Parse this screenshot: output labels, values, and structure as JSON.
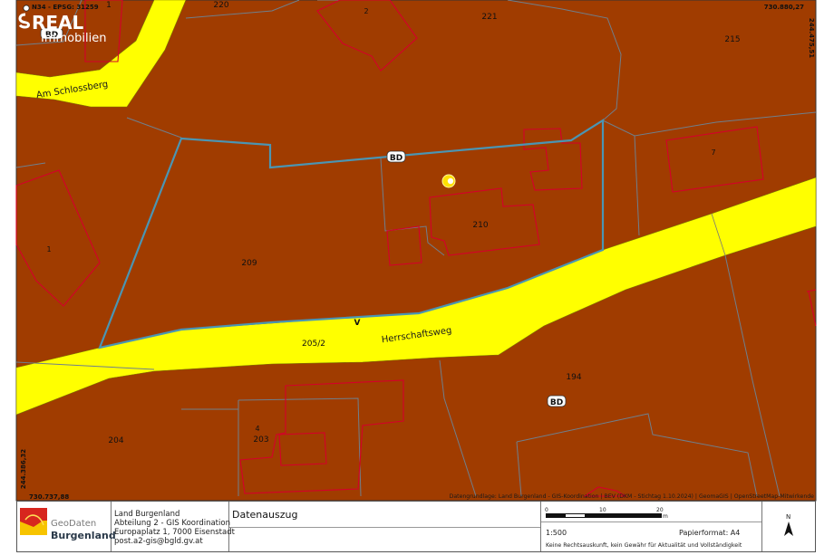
{
  "map": {
    "projection": "N34 - EPSG: 31259",
    "coord_top_right": "730.880,27",
    "coord_right_vertical": "244.475,51",
    "coord_left_vertical": "244.386,32",
    "coord_bottom_left": "730.737,88",
    "attribution": "Datengrundlage: Land Burgenland - GIS-Koordination | BEV (DKM - Stichtag 1.10.2024) | GeomaGIS | OpenStreetMap-Mitwirkende",
    "streets": {
      "am_schlossberg": "Am Schlossberg",
      "herrschaftsweg": "Herrschaftsweg"
    },
    "parcels": {
      "p220": "220",
      "p221": "221",
      "p215": "215",
      "p209": "209",
      "p210": "210",
      "p205_2": "205/2",
      "p194": "194",
      "p204": "204",
      "p203": "203",
      "p1_top": "1"
    },
    "house_numbers": {
      "h2": "2",
      "h7": "7",
      "h1": "1",
      "h4": "4"
    },
    "zone_badges": {
      "bd_top_left": "BD",
      "bd_center": "BD",
      "bd_bottom": "BD",
      "v": "V"
    },
    "colors": {
      "zone": "#a03c00",
      "road": "#ffff00",
      "selection": "#4a95b3",
      "building": "#d4002a"
    }
  },
  "brand": {
    "name_top": "REAL",
    "name_bottom": "Immobilien"
  },
  "footer": {
    "org_logo_top": "GeoDaten",
    "org_logo_bottom": "Burgenland",
    "org_line1": "Land Burgenland",
    "org_line2": "Abteilung 2 - GIS Koordination",
    "org_line3": "Europaplatz 1, 7000 Eisenstadt",
    "org_line4": "post.a2-gis@bgld.gv.at",
    "title": "Datenauszug",
    "scale_ticks": [
      "0",
      "10",
      "20"
    ],
    "scale_unit": "m",
    "scale": "1:500",
    "paper_format": "Papierformat: A4",
    "disclaimer": "Keine Rechtsauskunft, kein Gewähr für Aktualität und Vollständigkeit",
    "north": "N"
  }
}
